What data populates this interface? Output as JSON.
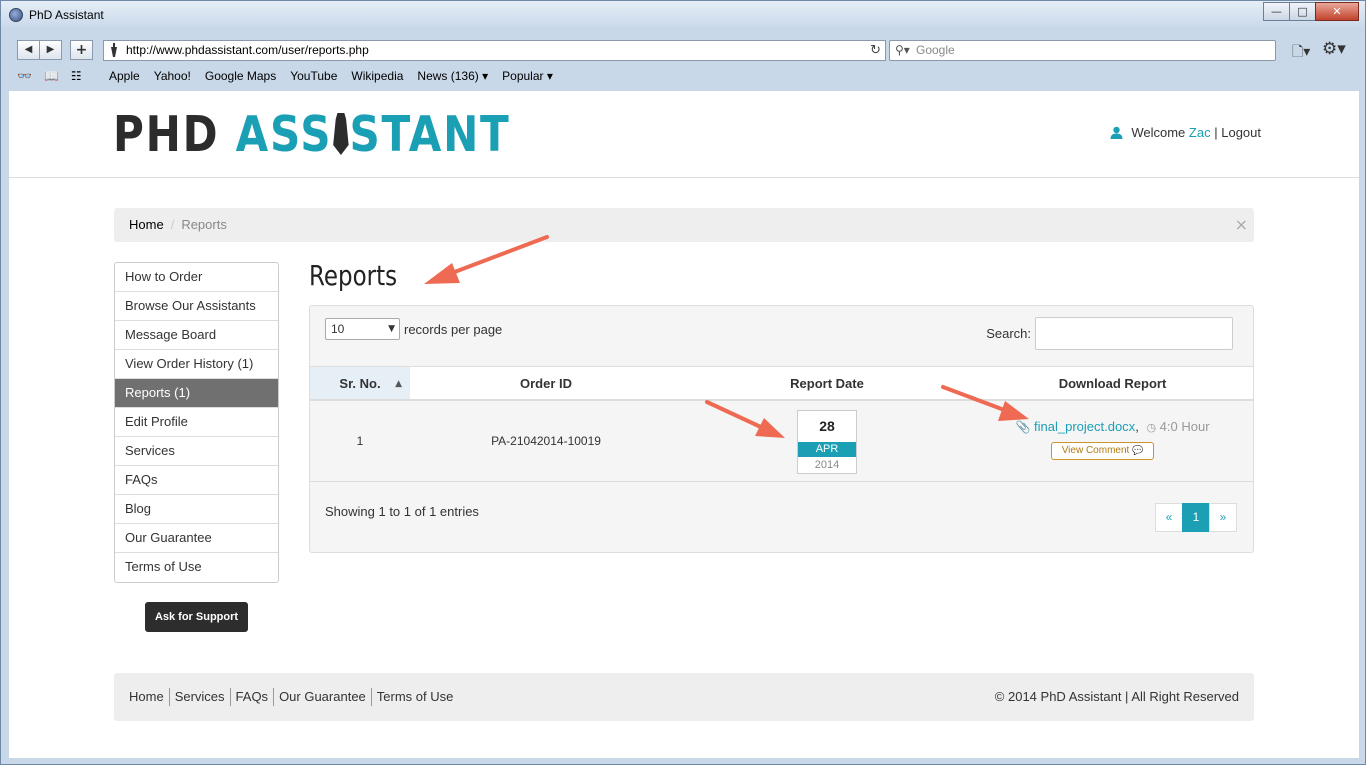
{
  "window": {
    "title": "PhD Assistant",
    "minimize": "—",
    "maximize": "□",
    "close": "✕"
  },
  "toolbar": {
    "back": "◀",
    "forward": "▶",
    "new_tab": "+",
    "url": "http://www.phdassistant.com/user/reports.php",
    "reload": "↻",
    "search_placeholder": "Google",
    "search_icon": "⚲▾",
    "page_icon": "🗋▾",
    "gear_icon": "⚙▾"
  },
  "bookmarks": {
    "icons": [
      "👓",
      "📖",
      "☷"
    ],
    "items": [
      "Apple",
      "Yahoo!",
      "Google Maps",
      "YouTube",
      "Wikipedia",
      "News (136) ▾",
      "Popular ▾"
    ]
  },
  "header": {
    "logo_part1": "PHD ",
    "logo_part2": "ASS",
    "logo_part3": "STANT",
    "welcome": "Welcome",
    "username": "Zac",
    "separator": "|",
    "logout": "Logout"
  },
  "breadcrumb": {
    "home": "Home",
    "separator": "/",
    "current": "Reports",
    "close": "×"
  },
  "sidebar": {
    "items": [
      {
        "label": "How to Order"
      },
      {
        "label": "Browse Our Assistants"
      },
      {
        "label": "Message Board"
      },
      {
        "label": "View Order History (1)"
      },
      {
        "label": "Reports (1)"
      },
      {
        "label": "Edit Profile"
      },
      {
        "label": "Services"
      },
      {
        "label": "FAQs"
      },
      {
        "label": "Blog"
      },
      {
        "label": "Our Guarantee"
      },
      {
        "label": "Terms of Use"
      }
    ],
    "support_button": "Ask for Support"
  },
  "main": {
    "title": "Reports",
    "length_value": "10",
    "length_suffix": "records per page",
    "search_label": "Search:",
    "columns": [
      "Sr. No.",
      "Order ID",
      "Report Date",
      "Download Report"
    ],
    "sort_icon": "▲",
    "rows": [
      {
        "sr": "1",
        "order_id": "PA-21042014-10019",
        "date_day": "28",
        "date_month": "APR",
        "date_year": "2014",
        "file_icon": "📎",
        "file": "final_project.docx",
        "comma": ",",
        "clock_icon": "◷",
        "duration": "4:0 Hour",
        "view_comment": "View Comment",
        "comment_icon": "💬"
      }
    ],
    "showing": "Showing 1 to 1 of 1 entries",
    "pager": [
      "«",
      "1",
      "»"
    ]
  },
  "footer": {
    "links": [
      "Home",
      "Services",
      "FAQs",
      "Our Guarantee",
      "Terms of Use"
    ],
    "copyright": "© 2014 PhD Assistant | All Right Reserved"
  },
  "colors": {
    "accent": "#1a9fb5",
    "arrow": "#ee6a52",
    "active_menu": "#707070"
  }
}
